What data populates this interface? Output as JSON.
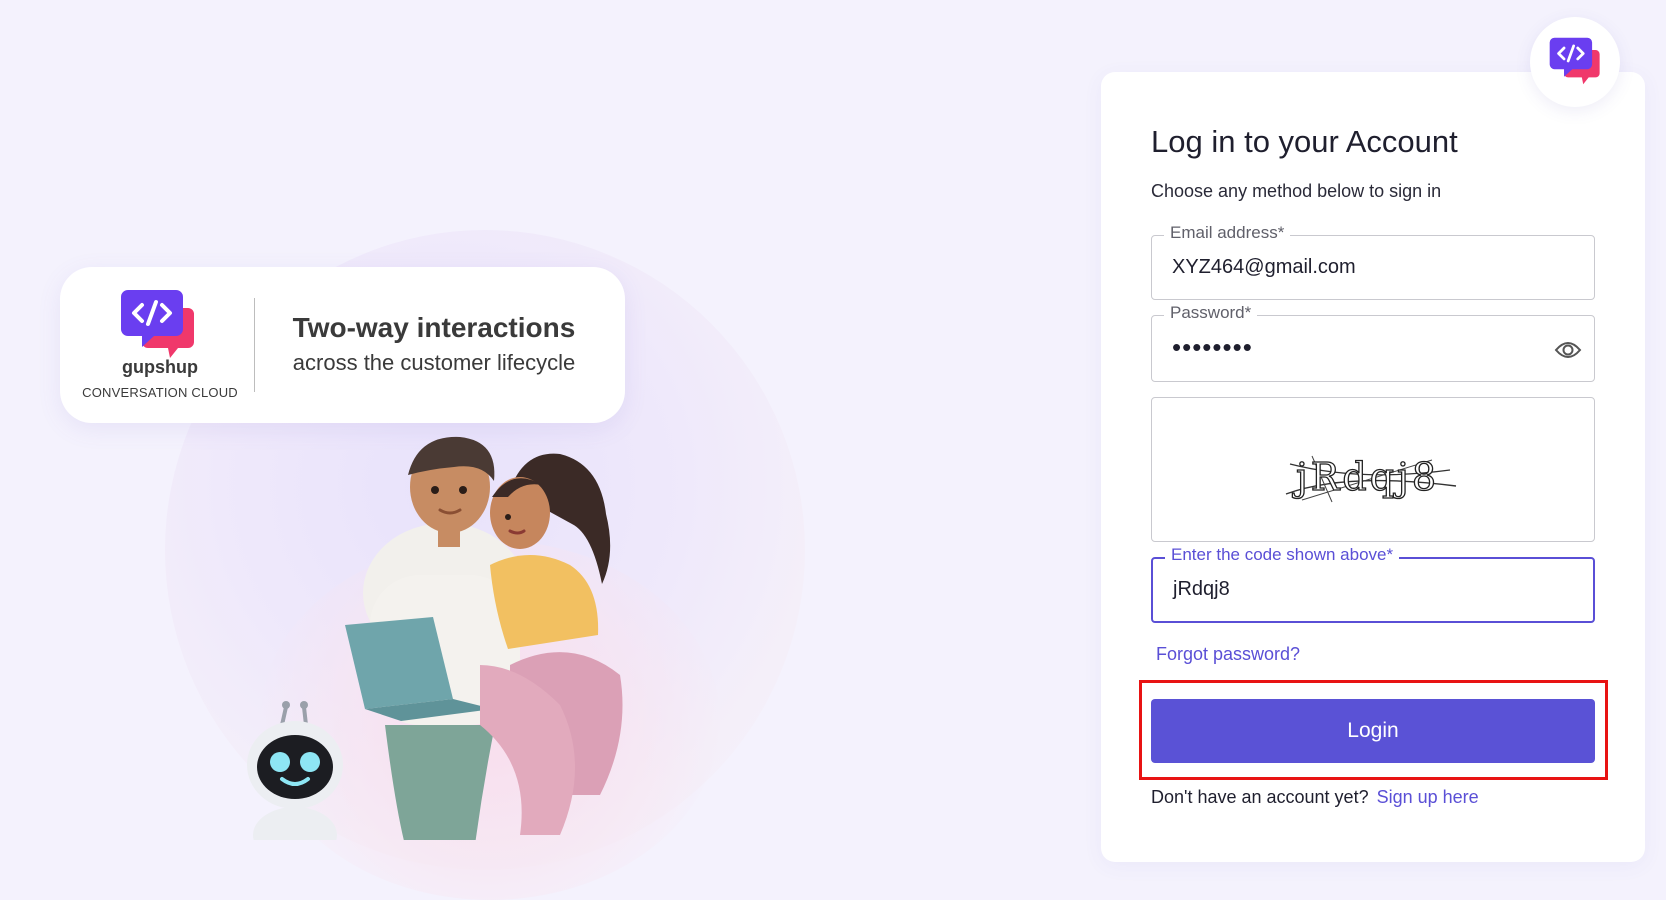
{
  "brand": {
    "name": "gupshup",
    "subtitle": "CONVERSATION CLOUD",
    "tagline_main": "Two-way interactions",
    "tagline_sub": "across the customer lifecycle"
  },
  "login": {
    "title": "Log in to your Account",
    "subtitle": "Choose any method below to sign in",
    "email": {
      "label": "Email address*",
      "value": "XYZ464@gmail.com"
    },
    "password": {
      "label": "Password*",
      "value": "••••••••"
    },
    "captcha": {
      "image_text": "jRdqj8",
      "label": "Enter the code shown above*",
      "value": "jRdqj8"
    },
    "forgot_link": "Forgot password?",
    "login_button": "Login",
    "signup_prompt": "Don't have an account yet?",
    "signup_link": "Sign up here"
  },
  "icons": {
    "logo": "chat-code-logo-icon",
    "password_toggle": "eye-icon"
  },
  "colors": {
    "accent": "#5a52d6",
    "logo_purple": "#6a3ef0",
    "logo_pink": "#f0386b",
    "highlight": "#e81313"
  }
}
